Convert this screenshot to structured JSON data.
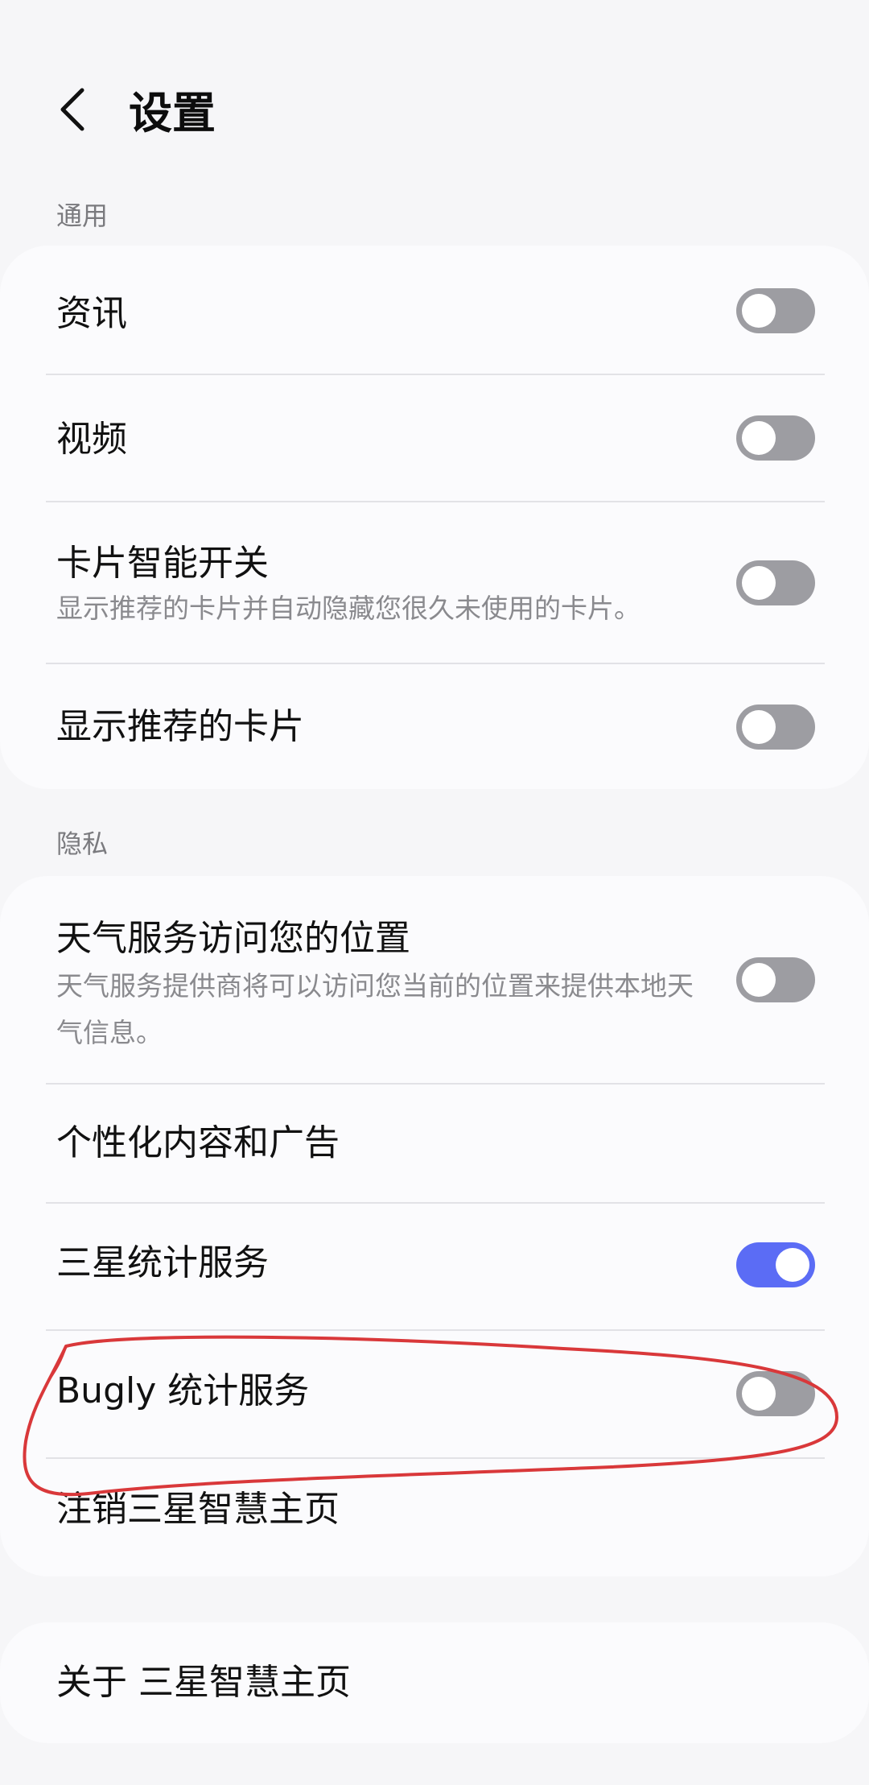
{
  "header": {
    "back_icon": "chevron-left-icon",
    "title": "设置"
  },
  "sections": {
    "general": {
      "title": "通用",
      "items": [
        {
          "title": "资讯",
          "subtitle": "",
          "toggle": "off"
        },
        {
          "title": "视频",
          "subtitle": "",
          "toggle": "off"
        },
        {
          "title": "卡片智能开关",
          "subtitle": "显示推荐的卡片并自动隐藏您很久未使用的卡片。",
          "toggle": "off"
        },
        {
          "title": "显示推荐的卡片",
          "subtitle": "",
          "toggle": "off"
        }
      ]
    },
    "privacy": {
      "title": "隐私",
      "items": [
        {
          "title": "天气服务访问您的位置",
          "subtitle": "天气服务提供商将可以访问您当前的位置来提供本地天气信息。",
          "toggle": "off"
        },
        {
          "title": "个性化内容和广告"
        },
        {
          "title": "三星统计服务",
          "toggle": "on"
        },
        {
          "title": "Bugly 统计服务",
          "toggle": "off"
        },
        {
          "title": "注销三星智慧主页"
        }
      ]
    },
    "about": {
      "items": [
        {
          "title": "关于 三星智慧主页"
        }
      ]
    }
  },
  "colors": {
    "background": "#f6f6f8",
    "card": "#fbfbfd",
    "toggle_on": "#5b6cf5",
    "toggle_off": "#9d9da2",
    "annotation": "#d9383a"
  }
}
